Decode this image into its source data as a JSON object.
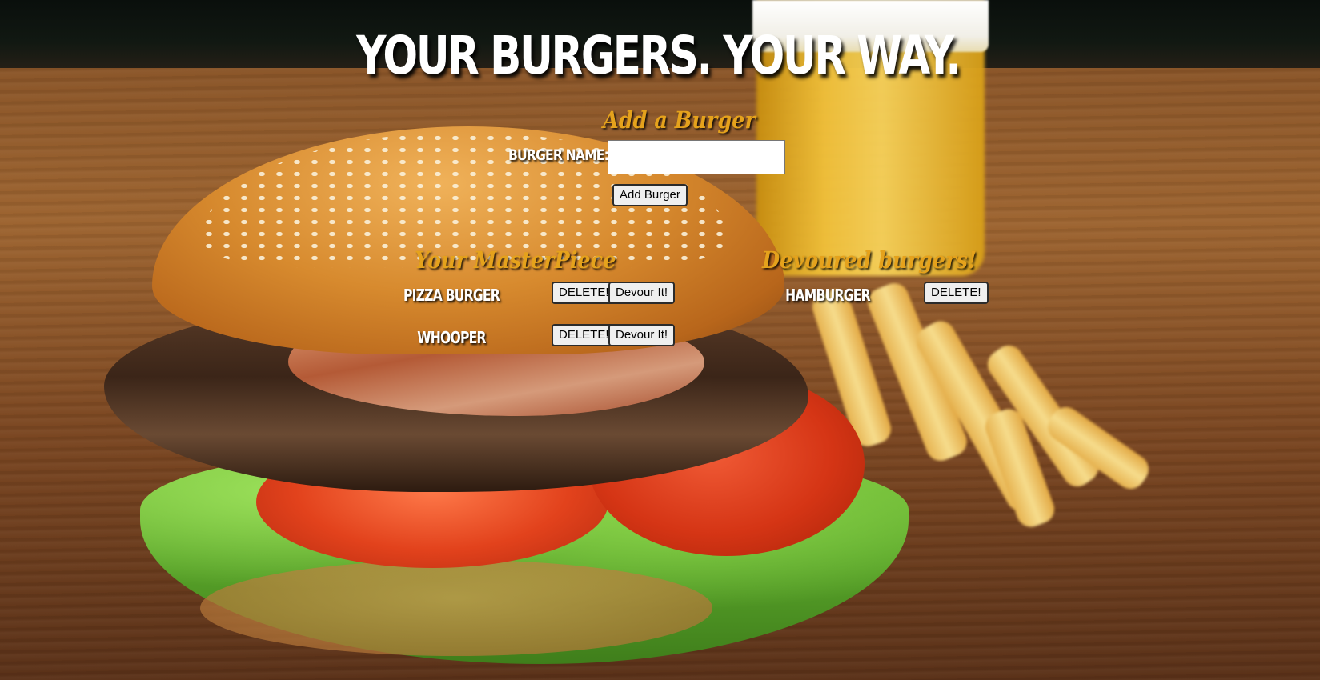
{
  "page": {
    "headline": "YOUR BURGERS. YOUR WAY."
  },
  "add_form": {
    "title": "Add a Burger",
    "label": "BURGER NAME:",
    "input_value": "",
    "input_placeholder": "",
    "submit_label": "Add Burger"
  },
  "masterpiece": {
    "title": "Your MasterPiece",
    "items": [
      {
        "name": "PIZZA BURGER",
        "delete_label": "DELETE!",
        "devour_label": "Devour It!"
      },
      {
        "name": "WHOOPER",
        "delete_label": "DELETE!",
        "devour_label": "Devour It!"
      }
    ]
  },
  "devoured": {
    "title": "Devoured burgers!",
    "items": [
      {
        "name": "HAMBURGER",
        "delete_label": "DELETE!"
      }
    ]
  },
  "colors": {
    "accent_title": "#e5a21c",
    "text_white": "#ffffff",
    "button_bg": "#efefef"
  }
}
